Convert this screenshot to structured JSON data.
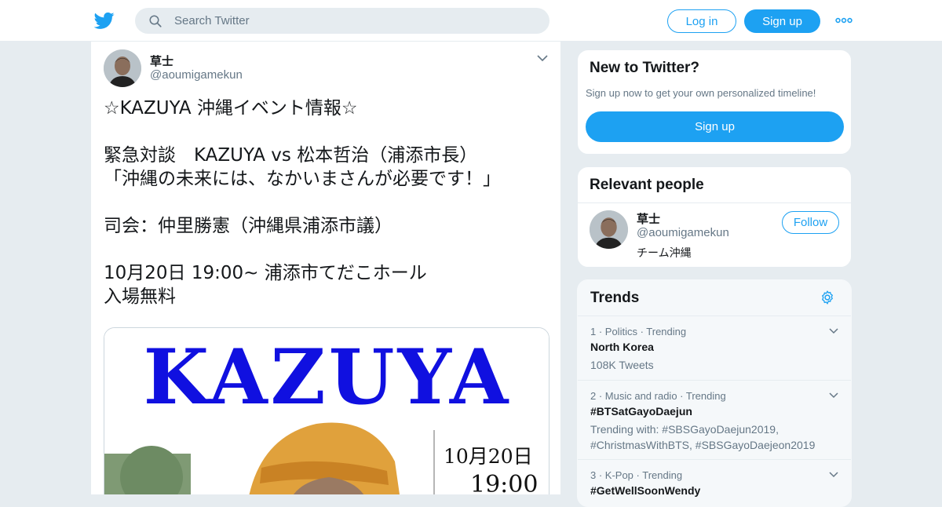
{
  "header": {
    "search_placeholder": "Search Twitter",
    "login_label": "Log in",
    "signup_label": "Sign up",
    "brand_color": "#1da1f2"
  },
  "tweet": {
    "author_name": "草士",
    "author_handle": "@aoumigamekun",
    "text": "☆KAZUYA 沖縄イベント情報☆\n\n緊急対談　KAZUYA vs 松本哲治（浦添市長）\n「沖縄の未来には、なかいまさんが必要です！」\n\n司会：仲里勝憲（沖縄県浦添市議）\n\n10月20日 19:00~ 浦添市てだこホール\n入場無料",
    "media": {
      "title": "KAZUYA",
      "date": "10月20日",
      "time": "19:00"
    }
  },
  "new_to_twitter": {
    "heading": "New to Twitter?",
    "subtext": "Sign up now to get your own personalized timeline!",
    "signup_label": "Sign up"
  },
  "relevant_people": {
    "heading": "Relevant people",
    "person": {
      "name": "草士",
      "handle": "@aoumigamekun",
      "bio": "チーム沖縄",
      "follow_label": "Follow"
    }
  },
  "trends": {
    "heading": "Trends",
    "items": [
      {
        "meta": "1 · Politics · Trending",
        "name": "North Korea",
        "sub": "108K Tweets"
      },
      {
        "meta": "2 · Music and radio · Trending",
        "name": "#BTSatGayoDaejun",
        "sub": "Trending with: #SBSGayoDaejun2019, #ChristmasWithBTS, #SBSGayoDaejeon2019"
      },
      {
        "meta": "3 · K-Pop · Trending",
        "name": "#GetWellSoonWendy",
        "sub": ""
      }
    ]
  },
  "icons": [
    "twitter-bird-icon",
    "search-icon",
    "more-dots-icon",
    "chevron-down-icon",
    "gear-icon"
  ]
}
